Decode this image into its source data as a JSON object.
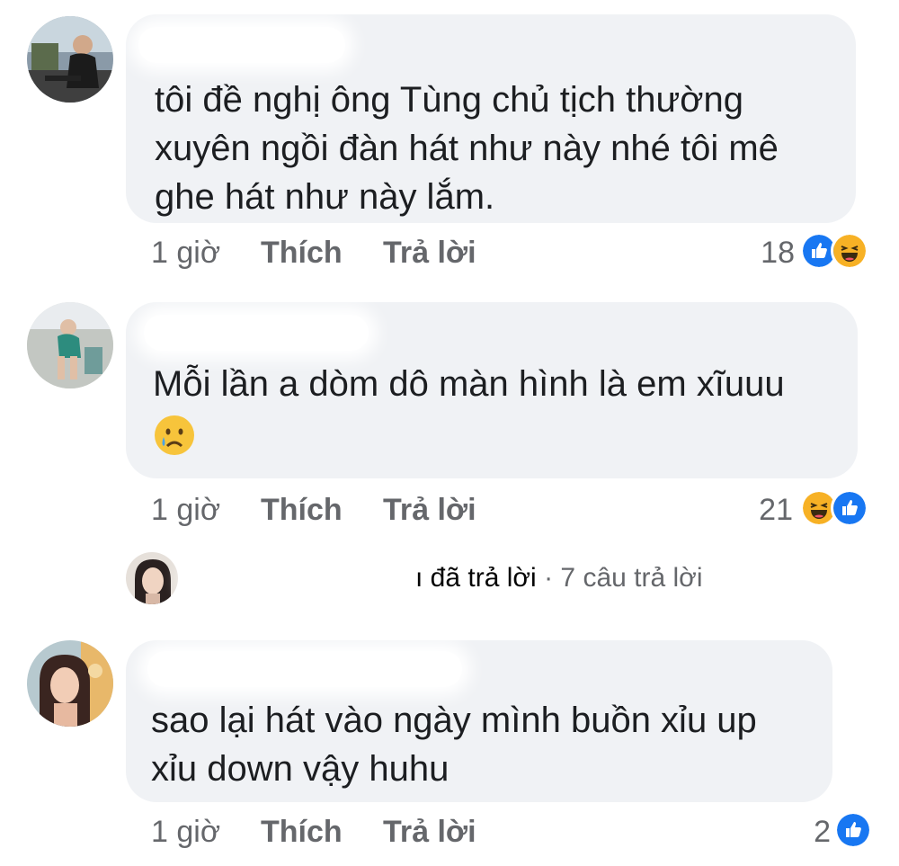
{
  "comments": [
    {
      "author_hidden": "",
      "text_lines": [
        "tôi đề nghị ông Tùng chủ tịch thường",
        "xuyên ngồi đàn hát như này nhé tôi mê",
        "ghe hát như này lắm."
      ],
      "time": "1 giờ",
      "like_label": "Thích",
      "reply_label": "Trả lời",
      "reaction_count": "18",
      "reactions": [
        "like-icon",
        "haha-icon"
      ]
    },
    {
      "author_hidden": "",
      "text_lines": [
        "Mỗi lần a dòm dô màn hình là em xĩuuu"
      ],
      "emoji": "crying-face-icon",
      "time": "1 giờ",
      "like_label": "Thích",
      "reply_label": "Trả lời",
      "reaction_count": "21",
      "reactions": [
        "haha-icon",
        "like-icon"
      ],
      "replies": {
        "replied_text": "ı đã trả lời",
        "separator": "·",
        "count_text": "7 câu trả lời"
      }
    },
    {
      "author_hidden": "",
      "text_lines": [
        "sao lại hát vào ngày mình buồn xỉu up",
        "xỉu down vậy huhu"
      ],
      "time": "1 giờ",
      "like_label": "Thích",
      "reply_label": "Trả lời",
      "reaction_count": "2",
      "reactions": [
        "like-icon"
      ]
    }
  ],
  "colors": {
    "bubble": "#f0f2f5",
    "meta": "#65676b",
    "like_blue": "#1877f2",
    "haha_yellow": "#f7b125"
  }
}
